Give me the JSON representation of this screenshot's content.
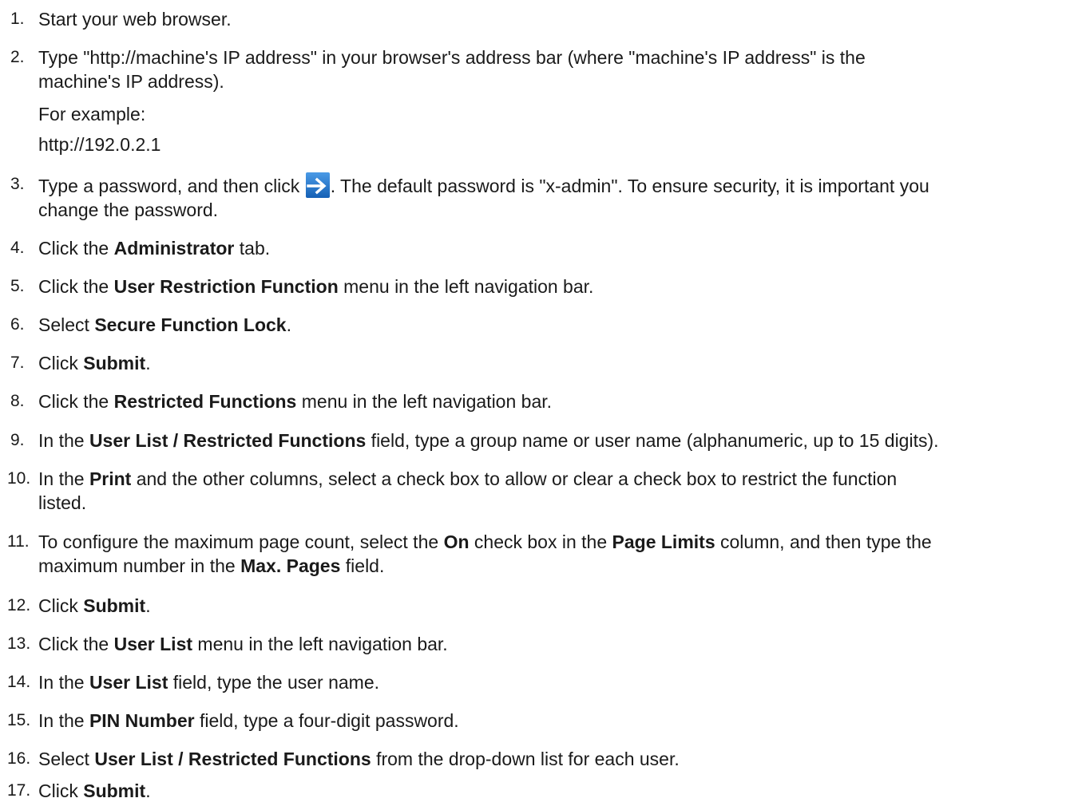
{
  "steps": [
    {
      "num": "1.",
      "parts": [
        "Start your web browser."
      ]
    },
    {
      "num": "2.",
      "line1": "Type \"http://machine's IP address\" in your browser's address bar (where \"machine's IP address\" is the",
      "line2": "machine's IP address).",
      "line3": "For example:",
      "line4": "http://192.0.2.1"
    },
    {
      "num": "3.",
      "pre": "Type a password, and then click ",
      "post": ". The default password is \"x-admin\". To ensure security, it is important you",
      "line2": "change the password."
    },
    {
      "num": "4.",
      "pre": "Click the ",
      "bold": "Administrator",
      "post": " tab."
    },
    {
      "num": "5.",
      "pre": "Click the ",
      "bold": "User Restriction Function",
      "post": " menu in the left navigation bar."
    },
    {
      "num": "6.",
      "pre": "Select ",
      "bold": "Secure Function Lock",
      "post": "."
    },
    {
      "num": "7.",
      "pre": "Click ",
      "bold": "Submit",
      "post": "."
    },
    {
      "num": "8.",
      "pre": "Click the ",
      "bold": "Restricted Functions",
      "post": " menu in the left navigation bar."
    },
    {
      "num": "9.",
      "pre": "In the ",
      "bold": "User List / Restricted Functions",
      "post": " field, type a group name or user name (alphanumeric, up to 15 digits)."
    },
    {
      "num": "10.",
      "pre": "In the ",
      "bold": "Print",
      "post": " and the other columns, select a check box to allow or clear a check box to restrict the function",
      "line2": "listed."
    },
    {
      "num": "11.",
      "pre": "To configure the maximum page count, select the ",
      "bold": "On",
      "mid": " check box in the ",
      "bold2": "Page Limits",
      "post": " column, and then type the",
      "line2pre": "maximum number in the ",
      "line2bold": "Max. Pages",
      "line2post": " field."
    },
    {
      "num": "12.",
      "pre": "Click ",
      "bold": "Submit",
      "post": "."
    },
    {
      "num": "13.",
      "pre": "Click the ",
      "bold": "User List",
      "post": " menu in the left navigation bar."
    },
    {
      "num": "14.",
      "pre": "In the ",
      "bold": "User List",
      "post": " field, type the user name."
    },
    {
      "num": "15.",
      "pre": "In the ",
      "bold": "PIN Number",
      "post": " field, type a four-digit password."
    },
    {
      "num": "16.",
      "pre": "Select ",
      "bold": "User List / Restricted Functions",
      "post": " from the drop-down list for each user."
    },
    {
      "num": "17.",
      "pre": "Click ",
      "bold": "Submit",
      "post": "."
    }
  ],
  "icons": {
    "go_arrow": "arrow-right-icon",
    "go_arrow_color": "#1d73c9"
  }
}
